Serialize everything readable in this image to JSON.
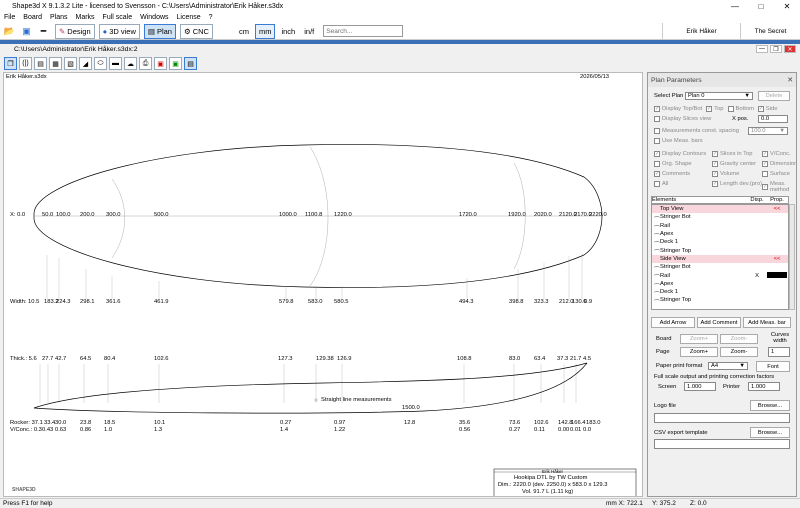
{
  "app": {
    "title": "Shape3d X 9.1.3.2 Lite - licensed to Svensson - C:\\Users\\Administrator\\Erik Håker.s3dx",
    "menu": [
      "File",
      "Board",
      "Plans",
      "Marks",
      "Full scale",
      "Windows",
      "License",
      "?"
    ],
    "toolbar": {
      "design": "Design",
      "view3d": "3D view",
      "plan": "Plan",
      "cnc": "CNC",
      "units": [
        "cm",
        "mm",
        "inch",
        "in/f"
      ],
      "selected_unit": "mm",
      "search_placeholder": "Search...",
      "tabs": [
        "Erik Håker",
        "The Secret"
      ]
    },
    "doc_title": "C:\\Users\\Administrator\\Erik Håker.s3dx:2"
  },
  "plan": {
    "name": "Erik Håker.s3dx",
    "date": "2026/05/13",
    "x_labels": [
      "X: 0.0",
      "50.0",
      "100.0",
      "200.0",
      "300.0",
      "500.0",
      "1000.0",
      "1100.8",
      "1220.0",
      "1720.0",
      "1920.0",
      "2020.0",
      "2120.0",
      "2170.0",
      "2220.0"
    ],
    "width_labels": [
      "Width: 10.5",
      "183.2",
      "224.3",
      "298.1",
      "361.6",
      "461.9",
      "579.8",
      "583.0",
      "580.5",
      "494.3",
      "398.8",
      "323.3",
      "212.0",
      "130.6",
      "0.9"
    ],
    "thick_labels": [
      "Thick.: 5.6",
      "27.7",
      "42.7",
      "64.5",
      "80.4",
      "102.6",
      "127.3",
      "129.38",
      "126.9",
      "108.8",
      "83.0",
      "63.4",
      "37.3",
      "21.7",
      "4.5"
    ],
    "straight_line": "Straight line measurements",
    "straight_value": "1500.0",
    "rocker_labels": [
      "Rocker: 37.1",
      "33.4",
      "30.0",
      "23.8",
      "18.5",
      "10.1",
      "0.27",
      "0.97",
      "12.8",
      "35.6",
      "73.6",
      "102.6",
      "142.8",
      "166.4",
      "183.0"
    ],
    "vconc_labels": [
      "V/Conc.: 0.3",
      "0.43",
      "0.63",
      "0.86",
      "1.0",
      "1.3",
      "1.4",
      "1.22",
      "0.56",
      "0.27",
      "0.11",
      "0.00",
      "0.01",
      "0.0"
    ],
    "info_box": {
      "name": "Erik Håker",
      "model": "Hookipa DTL by TW Custom",
      "dim": "Dim.: 2220.0 (dev. 2250.0) x 583.0 x 129.3",
      "vol": "Vol. 91.7 L (1.11 kg)"
    },
    "logo": "SHAPE3D"
  },
  "panel": {
    "title": "Plan Parameters",
    "select_plan_label": "Select Plan",
    "select_plan_value": "Plan 0",
    "delete": "Delete",
    "opts1": [
      {
        "label": "Display Top/Bot",
        "checked": true
      },
      {
        "label": "Top",
        "checked": true
      },
      {
        "label": "Bottom",
        "checked": false
      },
      {
        "label": "Side",
        "checked": true
      }
    ],
    "display_slices_view": "Display Slices view",
    "xpos_label": "X pos.",
    "xpos_value": "0.0",
    "measurements_const": "Measurements const. spacing",
    "spacing_value": "100.0",
    "use_meas_bars": "Use Meas. bars",
    "grid": [
      {
        "label": "Display Contours",
        "checked": true
      },
      {
        "label": "Slices in Top",
        "checked": true
      },
      {
        "label": "V/Conc.",
        "checked": true
      },
      {
        "label": "Org. Shape",
        "checked": false
      },
      {
        "label": "Gravity center",
        "checked": true
      },
      {
        "label": "Dimensions",
        "checked": true
      },
      {
        "label": "Comments",
        "checked": true
      },
      {
        "label": "Volume",
        "checked": true
      },
      {
        "label": "Surface",
        "checked": false
      },
      {
        "label": "All",
        "checked": false
      },
      {
        "label": "Length dev.(pro)",
        "checked": true
      },
      {
        "label": "Meas. method",
        "checked": true
      }
    ],
    "elements_header": {
      "name": "Elements",
      "disp": "Disp.",
      "prop": "Prop."
    },
    "elements": [
      {
        "name": "Top View",
        "group": true,
        "prop": "<<"
      },
      {
        "name": "Stringer Bot",
        "line": true
      },
      {
        "name": "Rail",
        "line": true
      },
      {
        "name": "Apex",
        "line": true
      },
      {
        "name": "Deck 1",
        "line": true
      },
      {
        "name": "Stringer Top",
        "line": true
      },
      {
        "name": "Side View",
        "group": true,
        "prop": "<<"
      },
      {
        "name": "Stringer Bot",
        "line": true
      },
      {
        "name": "Rail",
        "line": true,
        "disp": "X",
        "prop_black": true
      },
      {
        "name": "Apex",
        "line": true
      },
      {
        "name": "Deck 1",
        "line": true
      },
      {
        "name": "Stringer Top",
        "line": true
      }
    ],
    "add_arrow": "Add Arrow",
    "add_comment": "Add Comment",
    "add_meas_bar": "Add Meas. bar",
    "board_label": "Board",
    "page_label": "Page",
    "zoom_plus": "Zoom+",
    "zoom_minus": "Zoom-",
    "curves_width_label": "Curves width",
    "curves_width_value": "1",
    "paper_format_label": "Paper print format",
    "paper_format_value": "A4",
    "font": "Font",
    "fullscale_label": "Full scale output and printing correction factors",
    "screen_label": "Screen",
    "screen_value": "1.000",
    "printer_label": "Printer",
    "printer_value": "1.000",
    "logo_file_label": "Logo file",
    "browse": "Browse...",
    "csv_label": "CSV export template"
  },
  "status": {
    "help": "Press F1 for help",
    "x": "mm X: 722.1",
    "y": "Y: 375.2",
    "z": "Z: 0.0"
  }
}
